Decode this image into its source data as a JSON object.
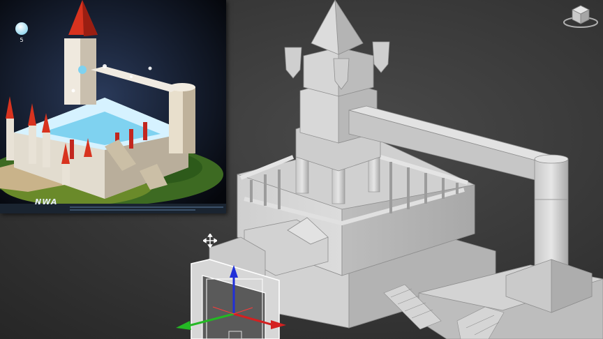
{
  "viewport": {
    "name": "3d-modeling-viewport",
    "background": "#3a3a3a",
    "model_color": "#d6d6d6",
    "selection_color": "#ffffff"
  },
  "reference_image": {
    "logo_text": "NWA",
    "counter_value": "5",
    "counter_icon": "bubble-icon"
  },
  "gizmo": {
    "x_color": "#d42020",
    "y_color": "#24b824",
    "z_color": "#2030d8",
    "icon": "transform-gizmo-icon"
  },
  "viewcube": {
    "icon": "viewcube-icon"
  },
  "cursor": {
    "icon": "move-cursor-icon"
  }
}
